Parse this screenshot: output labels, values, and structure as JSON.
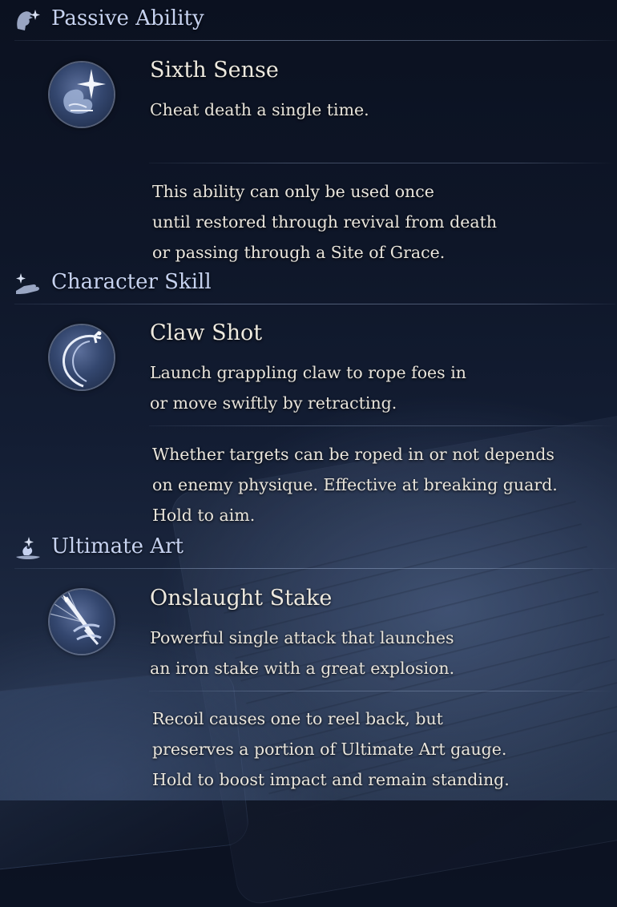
{
  "sections": [
    {
      "header_title": "Passive Ability",
      "header_icon": "wolf-head-sparkle-icon",
      "skill": {
        "icon": "sixth-sense-icon",
        "name": "Sixth Sense",
        "description": [
          "Cheat death a single time."
        ],
        "details": [
          "This ability can only be used once",
          "until restored through revival from death",
          "or passing through a Site of Grace."
        ]
      }
    },
    {
      "header_title": "Character Skill",
      "header_icon": "hand-sparkle-icon",
      "skill": {
        "icon": "claw-shot-icon",
        "name": "Claw Shot",
        "description": [
          "Launch grappling claw to rope foes in",
          "or move swiftly by retracting."
        ],
        "details": [
          "Whether targets can be roped in or not depends",
          "on enemy physique. Effective at breaking guard.",
          "Hold to aim."
        ]
      }
    },
    {
      "header_title": "Ultimate Art",
      "header_icon": "flame-swirl-icon",
      "skill": {
        "icon": "onslaught-stake-icon",
        "name": "Onslaught Stake",
        "description": [
          "Powerful single attack that launches",
          "an iron stake with a great explosion."
        ],
        "details": [
          "Recoil causes one to reel back, but",
          "preserves a portion of Ultimate Art gauge.",
          "Hold to boost impact and remain standing."
        ]
      }
    }
  ],
  "colors": {
    "header_text": "#c6d2f0",
    "body_text": "#e7e3da",
    "background_top": "#0b1120",
    "background_bottom": "#26344d"
  }
}
